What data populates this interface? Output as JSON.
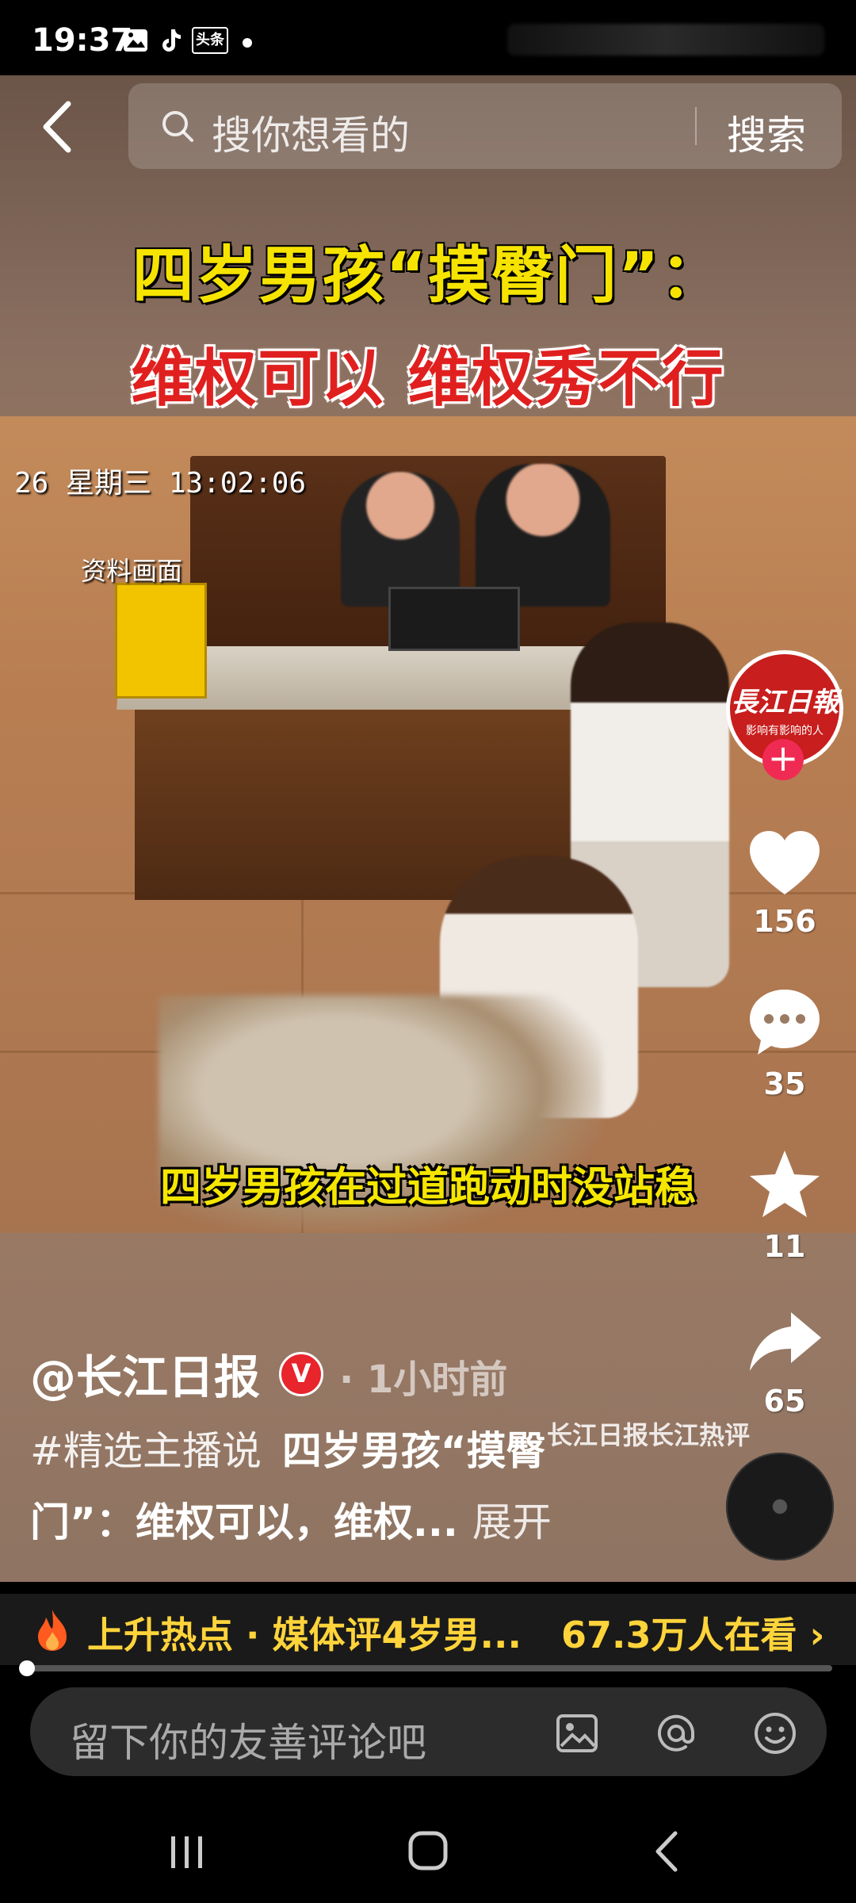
{
  "status_bar": {
    "time": "19:37",
    "toutiao_label": "头条"
  },
  "search": {
    "placeholder": "搜你想看的",
    "button": "搜索"
  },
  "video": {
    "headline_line1": "四岁男孩“摸臀门”：",
    "headline_line2": "维权可以  维权秀不行",
    "timestamp": "26 星期三 13:02:06",
    "archive_label": "资料画面",
    "subtitle": "四岁男孩在过道跑动时没站稳"
  },
  "avatar": {
    "name": "長江日報",
    "slogan": "影响有影响的人"
  },
  "actions": {
    "likes": "156",
    "comments": "35",
    "favorites": "11",
    "shares": "65"
  },
  "post": {
    "author": "@长江日报",
    "verified_badge": "V",
    "time_ago": "· 1小时前",
    "hashtag": "#精选主播说",
    "title_part1": "四岁男孩“摸臀",
    "title_part2": "门”：维权可以，维权...",
    "expand": "展开",
    "music": "长江日报长江热评"
  },
  "hot": {
    "text": "上升热点 · 媒体评4岁男...",
    "watching": "67.3万人在看 ›"
  },
  "progress": {
    "fraction": 0.0
  },
  "comment": {
    "placeholder": "留下你的友善评论吧"
  },
  "colors": {
    "hot_yellow": "#ffd43b",
    "headline_yellow": "#f6e400",
    "headline_red": "#e0201f",
    "follow_pink": "#f02b53"
  }
}
